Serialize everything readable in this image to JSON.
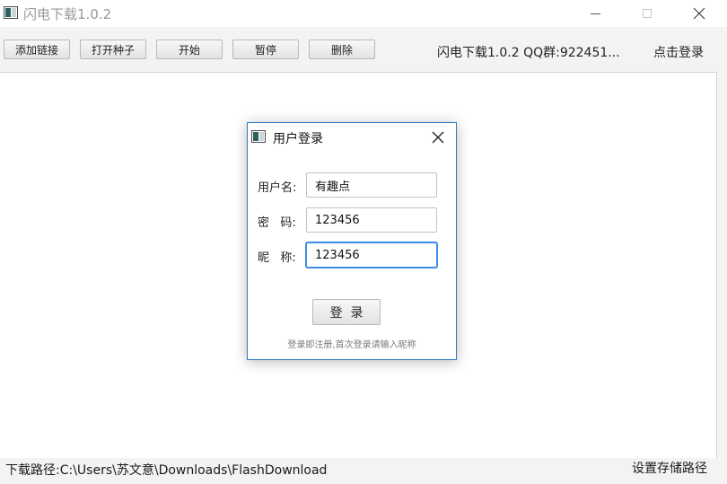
{
  "window": {
    "title": "闪电下载1.0.2"
  },
  "toolbar": {
    "buttons": [
      "添加链接",
      "打开种子",
      "开始",
      "暂停",
      "删除"
    ],
    "info": "闪电下载1.0.2  QQ群:922451...",
    "login_link": "点击登录"
  },
  "status": {
    "download_path": "下载路径:C:\\Users\\苏文意\\Downloads\\FlashDownload",
    "set_path_link": "设置存储路径"
  },
  "dialog": {
    "title": "用户登录",
    "username_label": "用户名:",
    "username_value": "有趣点",
    "password_label": "密   码:",
    "password_value": "123456",
    "nickname_label": "昵   称:",
    "nickname_value": "123456",
    "login_button": "登  录",
    "hint": "登录即注册,首次登录请输入昵称"
  },
  "colors": {
    "accent": "#2b79c2",
    "focus": "#3a8ee6"
  },
  "icons": {
    "app": "app-window-icon",
    "close": "close-icon",
    "minimize": "minimize-icon",
    "maximize": "maximize-icon"
  }
}
